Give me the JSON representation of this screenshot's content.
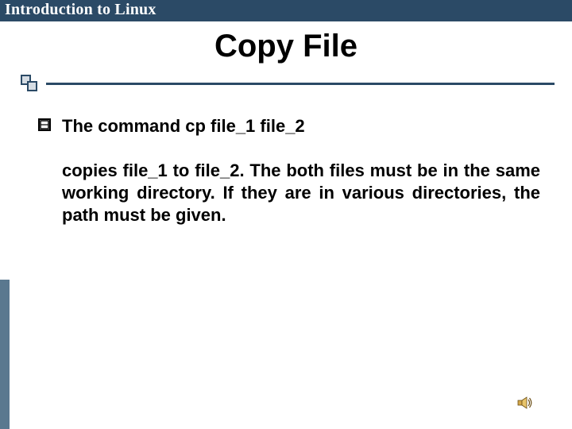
{
  "header": {
    "course_title": "Introduction to Linux"
  },
  "slide": {
    "title": "Copy File",
    "bullet": "The command cp file_1 file_2",
    "body": "copies file_1 to file_2. The both files must be in the same working directory. If they are in various directories, the path must be given."
  },
  "colors": {
    "accent": "#2b4a66",
    "leftbar": "#5a788f"
  },
  "icons": {
    "bullet": "square-bullet-icon",
    "audio": "speaker-icon"
  }
}
